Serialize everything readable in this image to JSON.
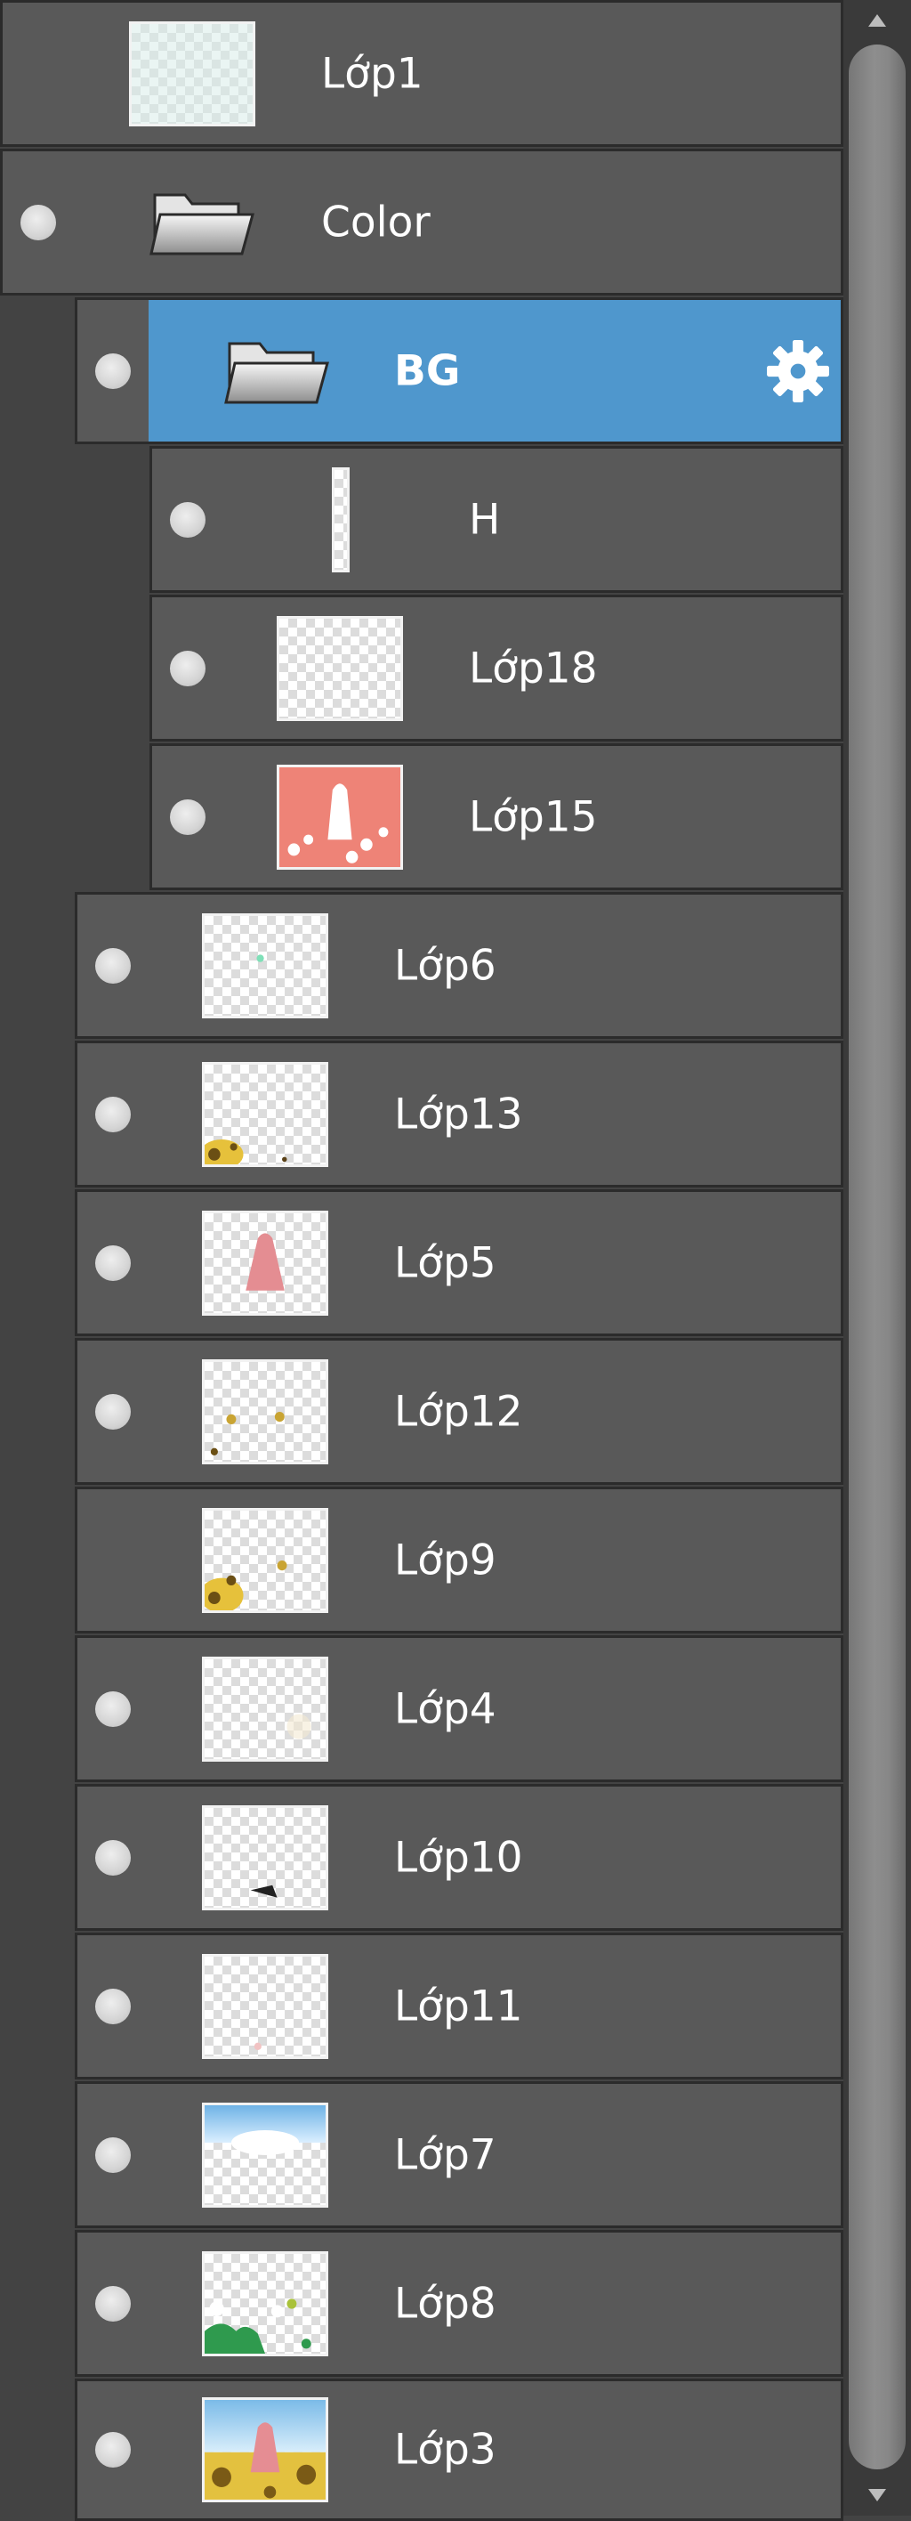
{
  "layers": [
    {
      "name": "Lớp1",
      "visible": false,
      "selected": false,
      "kind": "layer",
      "thumb": "lop1"
    },
    {
      "name": "Color",
      "visible": true,
      "selected": false,
      "kind": "folder"
    },
    {
      "name": "BG",
      "visible": true,
      "selected": true,
      "kind": "folder",
      "settings_icon": "gear-icon"
    },
    {
      "name": "H",
      "visible": true,
      "selected": false,
      "kind": "layer",
      "thumb": "h"
    },
    {
      "name": "Lớp18",
      "visible": true,
      "selected": false,
      "kind": "layer",
      "thumb": "empty"
    },
    {
      "name": "Lớp15",
      "visible": true,
      "selected": false,
      "kind": "layer",
      "thumb": "lop15"
    },
    {
      "name": "Lớp6",
      "visible": true,
      "selected": false,
      "kind": "layer",
      "thumb": "lop6"
    },
    {
      "name": "Lớp13",
      "visible": true,
      "selected": false,
      "kind": "layer",
      "thumb": "lop13"
    },
    {
      "name": "Lớp5",
      "visible": true,
      "selected": false,
      "kind": "layer",
      "thumb": "lop5"
    },
    {
      "name": "Lớp12",
      "visible": true,
      "selected": false,
      "kind": "layer",
      "thumb": "lop12"
    },
    {
      "name": "Lớp9",
      "visible": false,
      "selected": false,
      "kind": "layer",
      "thumb": "lop9"
    },
    {
      "name": "Lớp4",
      "visible": true,
      "selected": false,
      "kind": "layer",
      "thumb": "lop4"
    },
    {
      "name": "Lớp10",
      "visible": true,
      "selected": false,
      "kind": "layer",
      "thumb": "lop10"
    },
    {
      "name": "Lớp11",
      "visible": true,
      "selected": false,
      "kind": "layer",
      "thumb": "lop11"
    },
    {
      "name": "Lớp7",
      "visible": true,
      "selected": false,
      "kind": "layer",
      "thumb": "lop7"
    },
    {
      "name": "Lớp8",
      "visible": true,
      "selected": false,
      "kind": "layer",
      "thumb": "lop8"
    },
    {
      "name": "Lớp3",
      "visible": true,
      "selected": false,
      "kind": "layer",
      "thumb": "lop3"
    }
  ],
  "colors": {
    "panel_bg": "#595959",
    "selected_bg": "#4f97cd",
    "text": "#ffffff",
    "border": "#2b2b2b"
  },
  "scrollbar": {
    "up_icon": "arrow-up-icon",
    "down_icon": "arrow-down-icon"
  }
}
